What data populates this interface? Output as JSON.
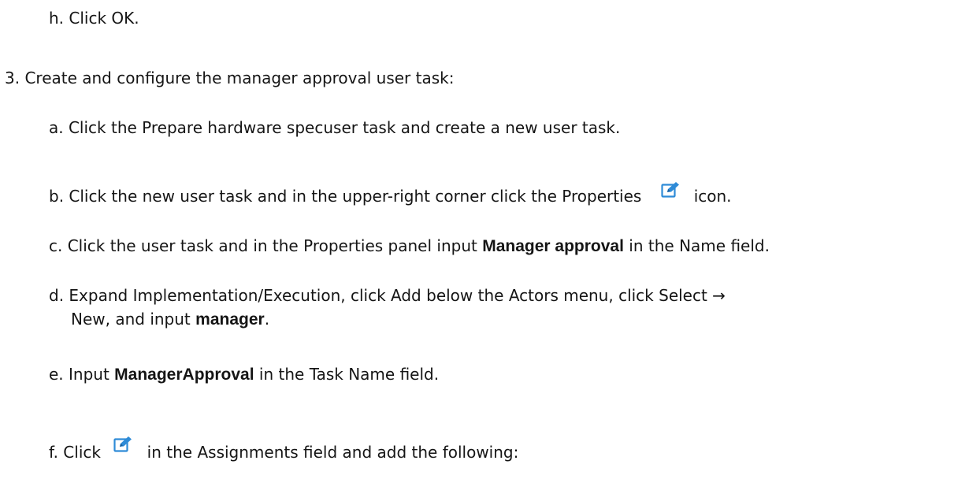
{
  "step_h": {
    "prefix": "h. Click ",
    "ok": "OK",
    "suffix": "."
  },
  "step_3": {
    "text": "3. Create and configure the manager approval user task:"
  },
  "step_a": {
    "prefix": "a. Click the ",
    "task": "Prepare hardware spec",
    "suffix": "user task and create a new user task."
  },
  "step_b": {
    "prefix": "b. Click the new user task and in the upper-right corner click the ",
    "properties": "Properties",
    "suffix": "icon."
  },
  "step_c": {
    "prefix": "c. Click the user task and in the ",
    "properties": "Properties",
    "mid1": " panel input ",
    "value": "Manager approval",
    "mid2": " in the ",
    "field": "Name",
    "suffix": " field."
  },
  "step_d": {
    "prefix": "d. Expand ",
    "section": "Implementation/Execution",
    "mid1": ", click ",
    "add": "Add",
    "mid2": " below the ",
    "actors": "Actors",
    "mid3": " menu, click ",
    "select": "Select →",
    "new": "New",
    "mid4": ", and input ",
    "value": "manager",
    "suffix": "."
  },
  "step_e": {
    "prefix": "e. Input ",
    "value": "ManagerApproval",
    "mid": " in the ",
    "field": "Task Name",
    "suffix": " field."
  },
  "step_f": {
    "prefix": "f. Click ",
    "mid": " in the ",
    "field": "Assignments",
    "suffix": " field and add the following:"
  },
  "icons": {
    "edit": "edit-icon",
    "color": "#2e8bd7"
  }
}
